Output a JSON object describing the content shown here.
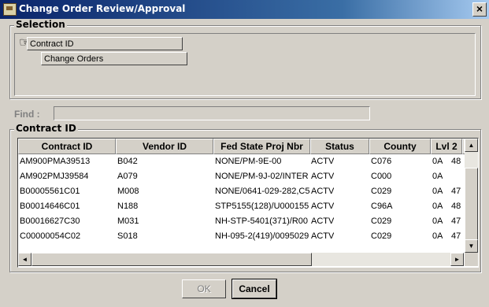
{
  "window": {
    "title": "Change Order Review/Approval",
    "close_label": "×"
  },
  "selection": {
    "legend": "Selection",
    "items": [
      {
        "label": "Contract ID"
      },
      {
        "label": "Change Orders"
      }
    ]
  },
  "find": {
    "label": "Find :",
    "value": ""
  },
  "contracts": {
    "legend": "Contract ID",
    "columns": [
      "Contract ID",
      "Vendor ID",
      "Fed State Proj Nbr",
      "Status",
      "County",
      "Lvl 2",
      "Lv"
    ],
    "rows": [
      [
        "AM900PMA39513",
        "B042",
        "NONE/PM-9E-00",
        "ACTV",
        "C076",
        "0A",
        "48"
      ],
      [
        "AM902PMJ39584",
        "A079",
        "NONE/PM-9J-02/INTER",
        "ACTV",
        "C000",
        "0A",
        ""
      ],
      [
        "B00005561C01",
        "M008",
        "NONE/0641-029-282,C5",
        "ACTV",
        "C029",
        "0A",
        "47"
      ],
      [
        "B00014646C01",
        "N188",
        "STP5155(128)/U000155",
        "ACTV",
        "C96A",
        "0A",
        "48"
      ],
      [
        "B00016627C30",
        "M031",
        "NH-STP-5401(371)/R00",
        "ACTV",
        "C029",
        "0A",
        "47"
      ],
      [
        "C00000054C02",
        "S018",
        "NH-095-2(419)/0095029",
        "ACTV",
        "C029",
        "0A",
        "47"
      ]
    ],
    "scroll_up": "▲",
    "scroll_down": "▼",
    "scroll_left": "◄",
    "scroll_right": "►"
  },
  "buttons": {
    "ok": "OK",
    "cancel": "Cancel"
  }
}
